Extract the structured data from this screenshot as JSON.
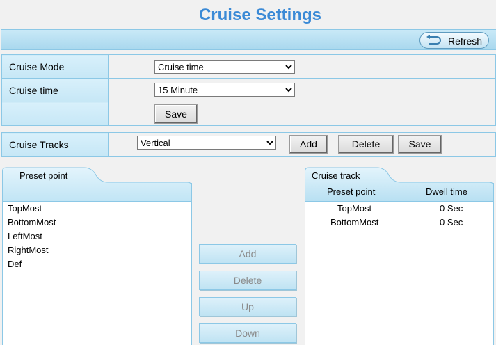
{
  "page": {
    "title": "Cruise Settings"
  },
  "toolbar": {
    "refresh_label": "Refresh"
  },
  "settings": {
    "cruise_mode_label": "Cruise Mode",
    "cruise_mode_value": "Cruise time",
    "cruise_time_label": "Cruise time",
    "cruise_time_value": "15 Minute",
    "save_label": "Save"
  },
  "tracks": {
    "label": "Cruise Tracks",
    "selected": "Vertical",
    "add_label": "Add",
    "delete_label": "Delete",
    "save_label": "Save"
  },
  "preset_panel": {
    "tab_label": "Preset point",
    "items": [
      "TopMost",
      "BottomMost",
      "LeftMost",
      "RightMost",
      "Def"
    ]
  },
  "actions": {
    "add": "Add",
    "delete": "Delete",
    "up": "Up",
    "down": "Down"
  },
  "track_panel": {
    "tab_label": "Cruise track",
    "col_preset": "Preset point",
    "col_dwell": "Dwell time",
    "rows": [
      {
        "preset": "TopMost",
        "dwell": "0 Sec"
      },
      {
        "preset": "BottomMost",
        "dwell": "0 Sec"
      }
    ]
  }
}
